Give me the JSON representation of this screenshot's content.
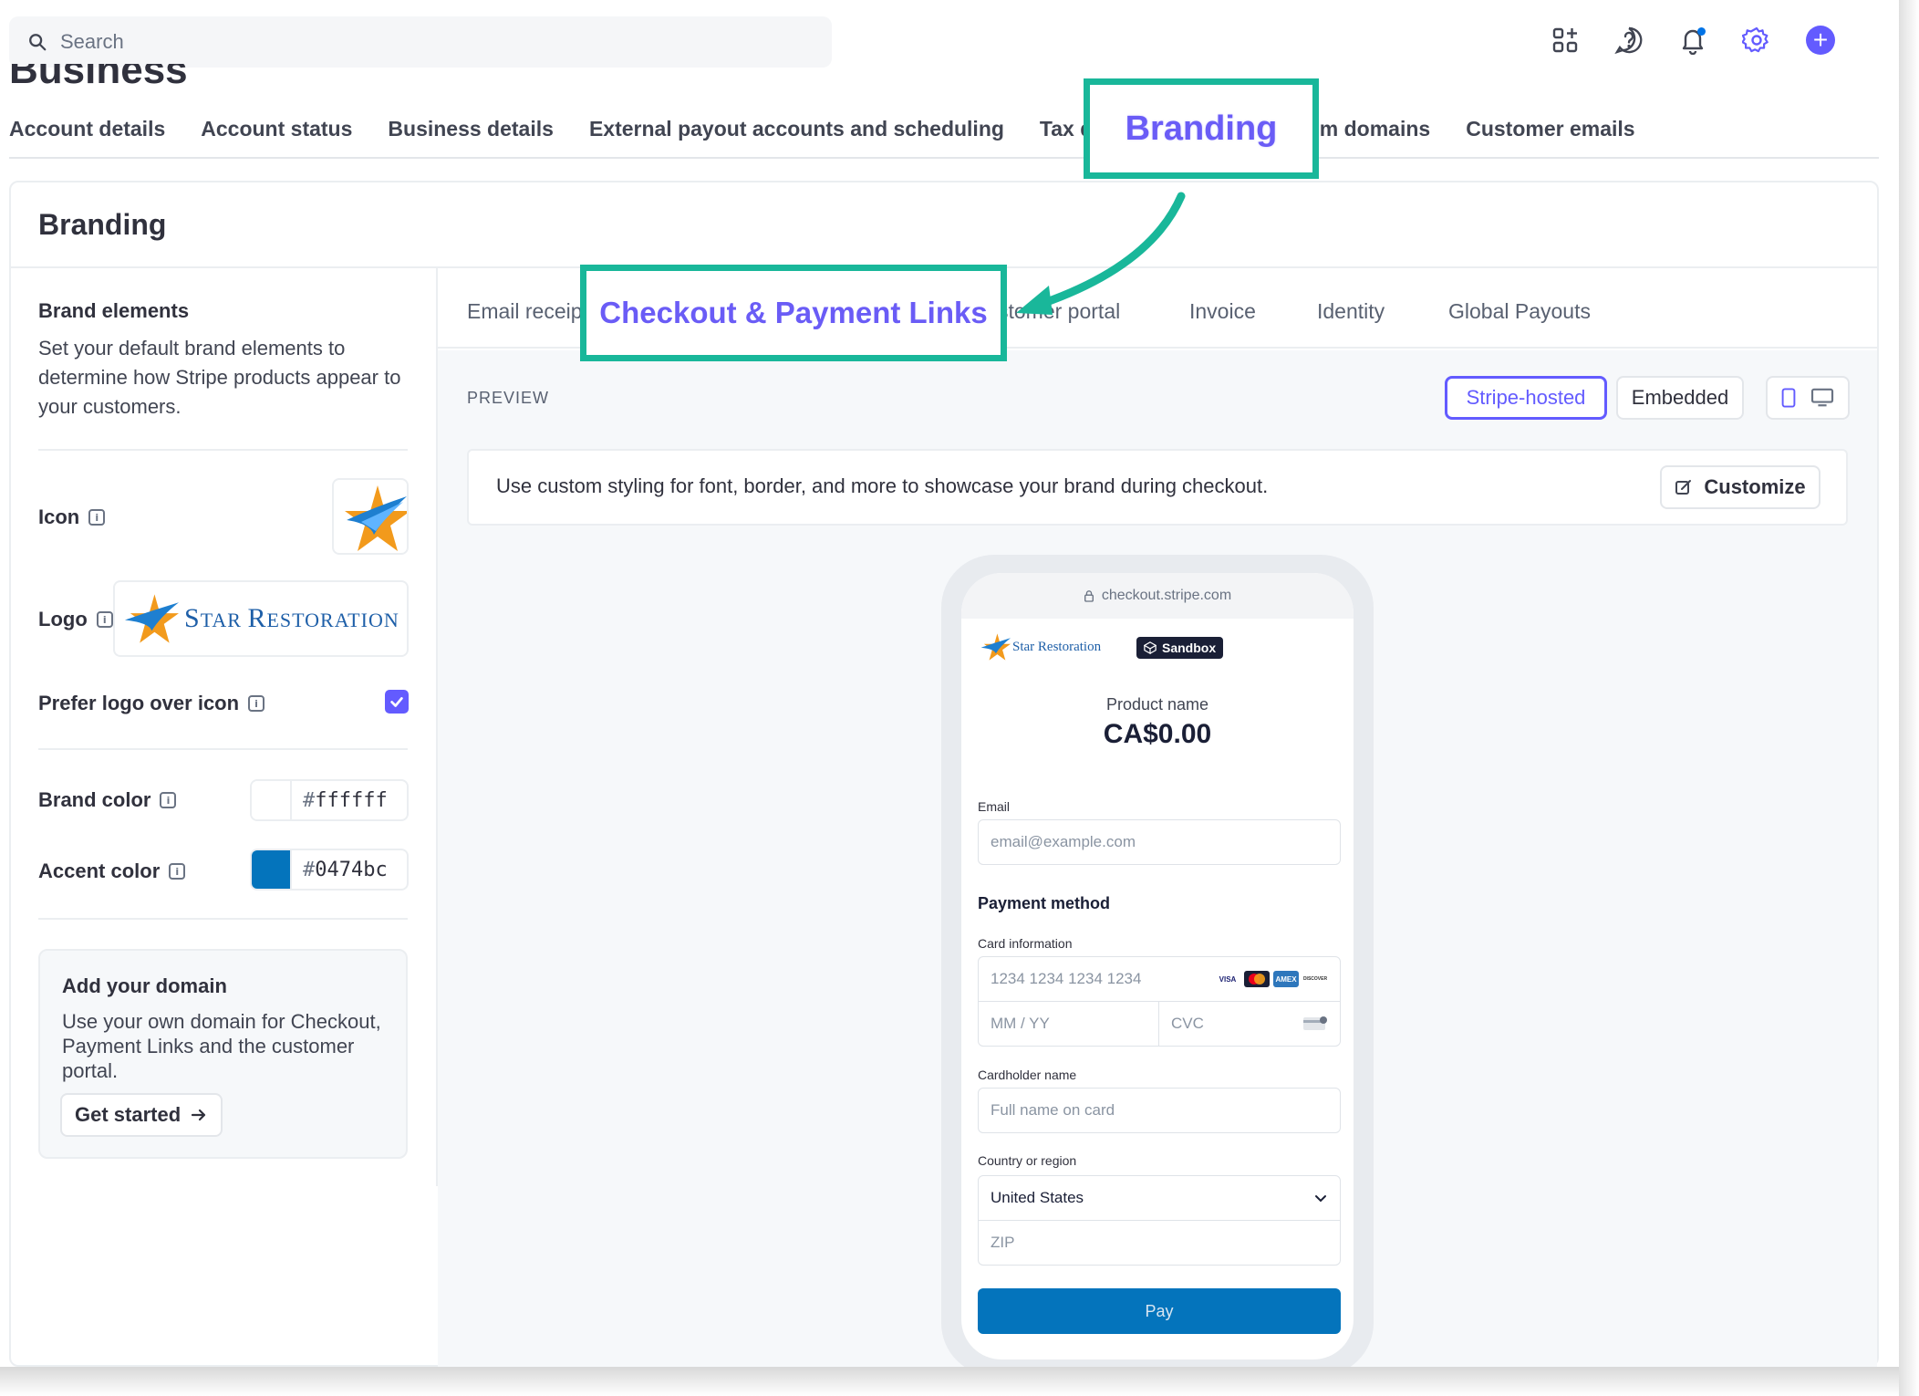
{
  "search": {
    "placeholder": "Search"
  },
  "page_title_partial": "Business",
  "top_tabs": [
    "Account details",
    "Account status",
    "Business details",
    "External payout accounts and scheduling",
    "Tax de",
    "tom domains",
    "Customer emails"
  ],
  "card": {
    "title": "Branding"
  },
  "brand_elements": {
    "title": "Brand elements",
    "description": "Set your default brand elements to determine how Stripe products appear to your customers.",
    "icon_label": "Icon",
    "logo_label": "Logo",
    "logo_text_big1": "S",
    "logo_text_small1": "TAR ",
    "logo_text_big2": "R",
    "logo_text_small2": "ESTORATION",
    "prefer_logo_label": "Prefer logo over icon",
    "prefer_logo_checked": true,
    "brand_color_label": "Brand color",
    "brand_color_hash": "#",
    "brand_color_value": "ffffff",
    "brand_color": "#ffffff",
    "accent_color_label": "Accent color",
    "accent_color_hash": "#",
    "accent_color_value": "0474bc",
    "accent_color": "#0474bc"
  },
  "domain_box": {
    "title": "Add your domain",
    "description": "Use your own domain for Checkout, Payment Links and the customer portal.",
    "button": "Get started"
  },
  "sub_tabs": [
    "Email receip",
    "stomer portal",
    "Invoice",
    "Identity",
    "Global Payouts"
  ],
  "preview": {
    "label": "PREVIEW",
    "mode_active": "Stripe-hosted",
    "mode_other": "Embedded",
    "banner_text": "Use custom styling for font, border, and more to showcase your brand during checkout.",
    "customize_button": "Customize"
  },
  "checkout": {
    "url": "checkout.stripe.com",
    "logo_text": "Star Restoration",
    "sandbox_badge": "Sandbox",
    "product_name": "Product name",
    "price": "CA$0.00",
    "email_label": "Email",
    "email_placeholder": "email@example.com",
    "payment_method_title": "Payment method",
    "card_info_label": "Card information",
    "card_number_placeholder": "1234 1234 1234 1234",
    "expiry_placeholder": "MM / YY",
    "cvc_placeholder": "CVC",
    "cardholder_label": "Cardholder name",
    "cardholder_placeholder": "Full name on card",
    "country_label": "Country or region",
    "country_value": "United States",
    "zip_placeholder": "ZIP",
    "pay_button": "Pay",
    "card_brands": [
      "VISA",
      "MC",
      "AMEX",
      "DISCOVER"
    ]
  },
  "annotations": {
    "branding_callout": "Branding",
    "checkout_callout": "Checkout & Payment Links",
    "callout_color": "#19b79a",
    "callout_text_color": "#6a5cf6"
  },
  "icons": [
    "search-icon",
    "apps-icon",
    "help-icon",
    "bell-icon",
    "gear-icon",
    "plus-icon",
    "info-icon",
    "check-icon",
    "arrow-right-icon",
    "phone-icon",
    "desktop-icon",
    "edit-icon",
    "lock-icon",
    "chevron-down-icon",
    "cvc-card-icon",
    "star-logo-icon",
    "sandbox-cube-icon"
  ]
}
